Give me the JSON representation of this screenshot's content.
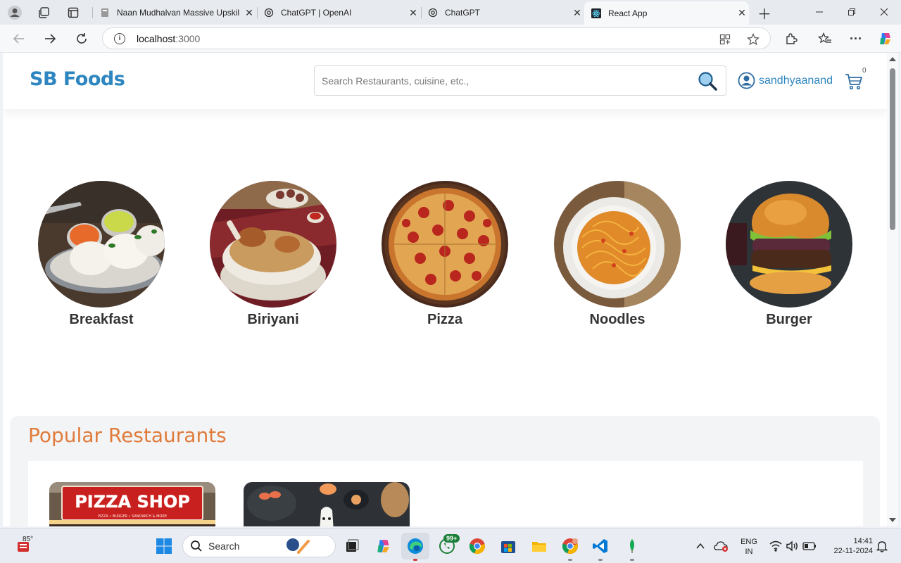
{
  "browser": {
    "tabs": [
      {
        "title": "Naan Mudhalvan Massive Upskil"
      },
      {
        "title": "ChatGPT | OpenAI"
      },
      {
        "title": "ChatGPT"
      },
      {
        "title": "React App"
      }
    ],
    "url": {
      "host": "localhost",
      "port": ":3000"
    }
  },
  "app": {
    "brand": "SB Foods",
    "search_placeholder": "Search Restaurants, cuisine, etc.,",
    "username": "sandhyaanand",
    "cart_count": "0",
    "categories": [
      {
        "label": "Breakfast"
      },
      {
        "label": "Biriyani"
      },
      {
        "label": "Pizza"
      },
      {
        "label": "Noodles"
      },
      {
        "label": "Burger"
      }
    ],
    "popular_title": "Popular Restaurants",
    "restaurants": [
      {
        "sign": "PIZZA SHOP",
        "sub": "PIZZA • BURGER • SANDWICH & MORE"
      },
      {
        "sign": ""
      }
    ]
  },
  "taskbar": {
    "weather": "85°",
    "search_label": "Search",
    "whatsapp_badge": "99+",
    "lang_top": "ENG",
    "lang_bottom": "IN",
    "time": "14:41",
    "date": "22-11-2024"
  },
  "colors": {
    "brand": "#2e86c1",
    "accent": "#e07b3a"
  }
}
